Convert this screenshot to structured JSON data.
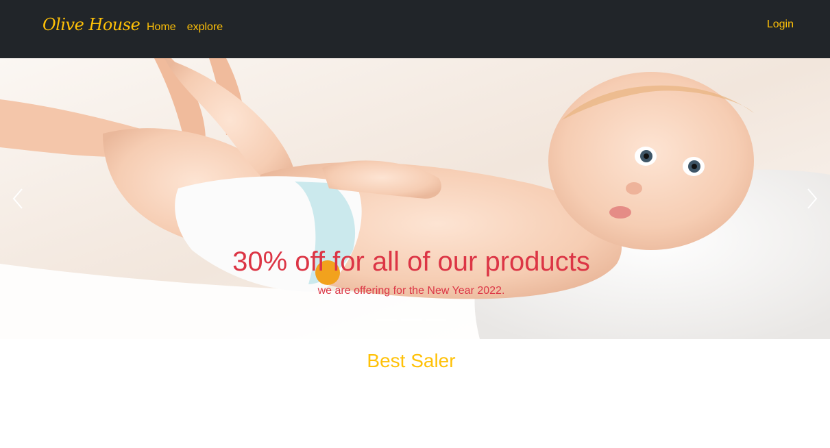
{
  "navbar": {
    "brand": "Olive House",
    "links": [
      {
        "label": "Home"
      },
      {
        "label": "explore"
      }
    ],
    "login_label": "Login"
  },
  "carousel": {
    "slide_image": "baby-diaper-photo",
    "caption_title": "30% off for all of our products",
    "caption_subtitle": "we are offering for the New Year 2022.",
    "indicators": 3,
    "active_indicator": 1,
    "prev_icon": "chevron-left-icon",
    "next_icon": "chevron-right-icon"
  },
  "best_saler": {
    "title": "Best Saler"
  },
  "colors": {
    "navbar_bg": "#212529",
    "accent": "#ffc107",
    "caption": "#dc3545"
  }
}
